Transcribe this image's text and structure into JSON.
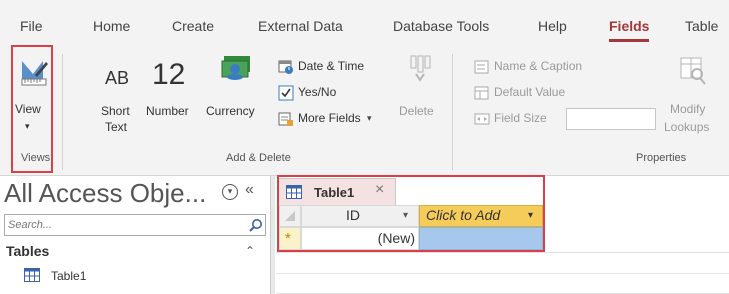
{
  "tabs": [
    {
      "label": "File",
      "active": false
    },
    {
      "label": "Home",
      "active": false
    },
    {
      "label": "Create",
      "active": false
    },
    {
      "label": "External Data",
      "active": false
    },
    {
      "label": "Database Tools",
      "active": false
    },
    {
      "label": "Help",
      "active": false
    },
    {
      "label": "Fields",
      "active": true
    },
    {
      "label": "Table",
      "active": false
    }
  ],
  "ribbon": {
    "views": {
      "view_label": "View",
      "group_label": "Views"
    },
    "add_delete": {
      "short_text_glyph": "AB",
      "short_text_line1": "Short",
      "short_text_line2": "Text",
      "number_glyph": "12",
      "number_label": "Number",
      "currency_label": "Currency",
      "date_time_label": "Date & Time",
      "yes_no_label": "Yes/No",
      "more_fields_label": "More Fields",
      "delete_label": "Delete",
      "group_label": "Add & Delete"
    },
    "properties": {
      "name_caption_label": "Name & Caption",
      "default_value_label": "Default Value",
      "field_size_label": "Field Size",
      "field_size_value": "",
      "modify_lookups_line1": "Modify",
      "modify_lookups_line2": "Lookups",
      "group_label": "Properties"
    }
  },
  "nav_pane": {
    "title": "All Access Obje...",
    "search_placeholder": "Search...",
    "section_label": "Tables",
    "items": [
      {
        "label": "Table1",
        "icon": "table-icon"
      }
    ]
  },
  "datasheet": {
    "tab_label": "Table1",
    "columns": [
      {
        "header": "ID",
        "has_dropdown": true
      },
      {
        "header": "Click to Add",
        "has_dropdown": true
      }
    ],
    "new_row": {
      "marker": "*",
      "id_value": "(New)",
      "add_value": ""
    }
  },
  "colors": {
    "accent": "#a4373a",
    "highlight_box": "#d9404a",
    "click_to_add_bg": "#f5cc5a",
    "selected_cell": "#a6c8ec",
    "ribbon_bg": "#f3f3f3"
  }
}
